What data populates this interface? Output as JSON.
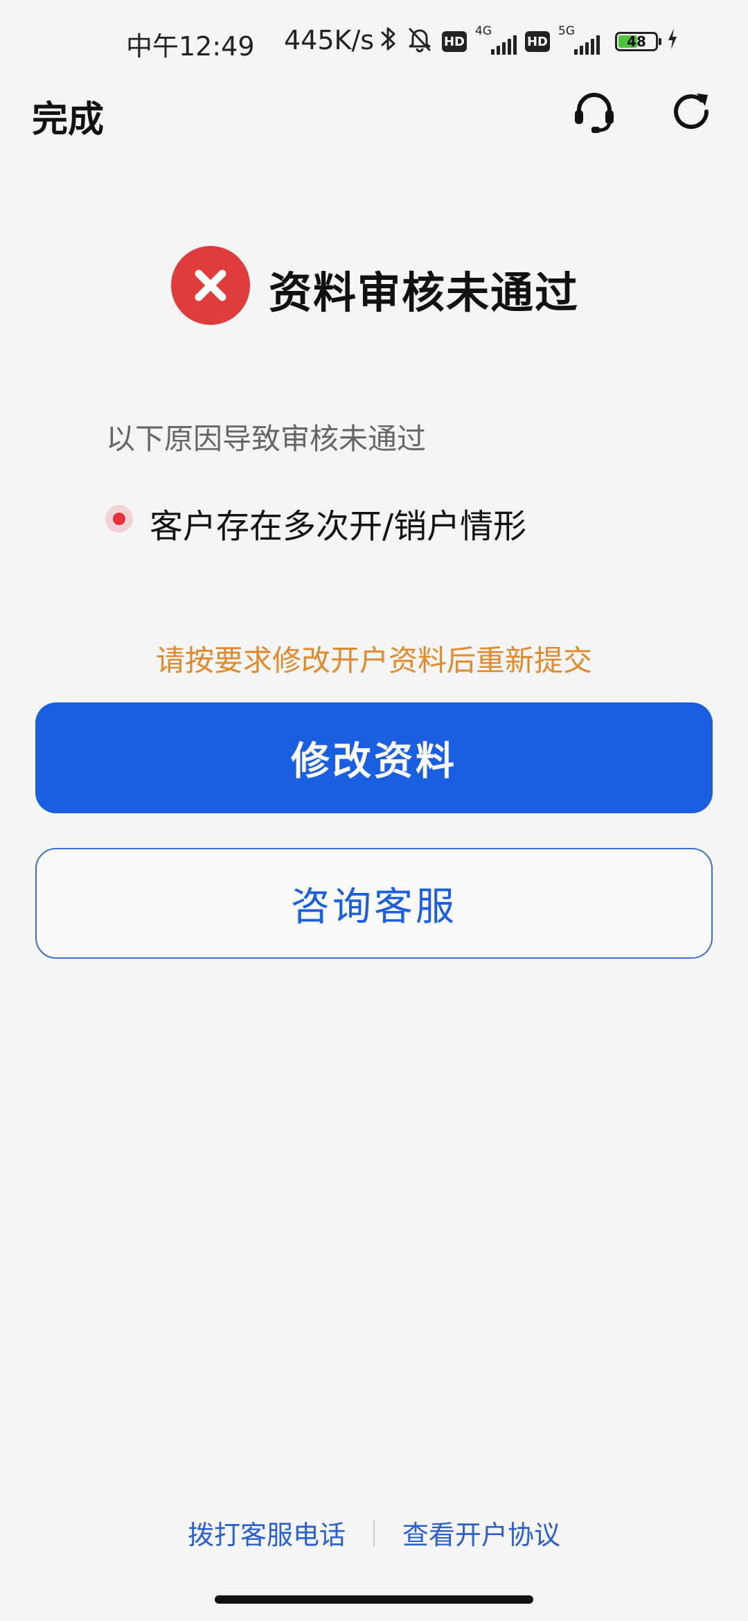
{
  "status_bar": {
    "time": "中午12:49",
    "net_speed": "445K/s",
    "hd_label": "HD",
    "sim1_tech": "4G",
    "sim2_tech": "5G",
    "battery": "48",
    "icons": [
      "bluetooth-icon",
      "mute-bell-icon",
      "hd-icon",
      "signal-4g-icon",
      "hd-icon",
      "signal-5g-icon",
      "battery-icon",
      "charging-icon"
    ]
  },
  "header": {
    "done_label": "完成",
    "icons": [
      "headset-icon",
      "refresh-icon"
    ]
  },
  "result": {
    "status_icon": "error-x-icon",
    "status_color": "#e03c3c",
    "title": "资料审核未通过",
    "reason_intro": "以下原因导致审核未通过",
    "reasons": [
      "客户存在多次开/销户情形"
    ],
    "hint": "请按要求修改开户资料后重新提交",
    "hint_color": "#e08a2c"
  },
  "actions": {
    "primary_label": "修改资料",
    "secondary_label": "咨询客服",
    "accent_color": "#1a5fe0"
  },
  "footer": {
    "call_service": "拨打客服电话",
    "view_agreement": "查看开户协议"
  }
}
